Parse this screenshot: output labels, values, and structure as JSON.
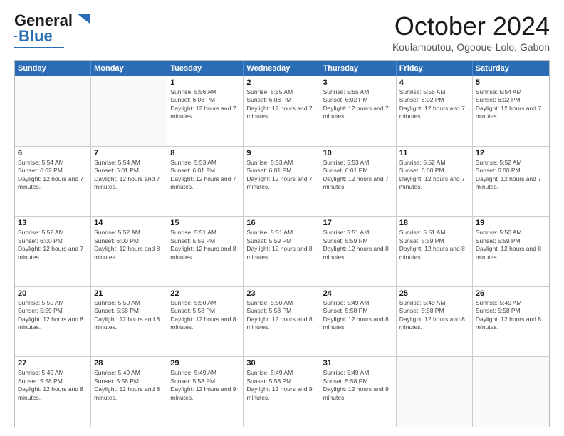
{
  "logo": {
    "line1": "General",
    "line2": "Blue"
  },
  "header": {
    "title": "October 2024",
    "location": "Koulamoutou, Ogooue-Lolo, Gabon"
  },
  "days_of_week": [
    "Sunday",
    "Monday",
    "Tuesday",
    "Wednesday",
    "Thursday",
    "Friday",
    "Saturday"
  ],
  "weeks": [
    [
      {
        "day": "",
        "content": ""
      },
      {
        "day": "",
        "content": ""
      },
      {
        "day": "1",
        "content": "Sunrise: 5:56 AM\nSunset: 6:03 PM\nDaylight: 12 hours and 7 minutes."
      },
      {
        "day": "2",
        "content": "Sunrise: 5:55 AM\nSunset: 6:03 PM\nDaylight: 12 hours and 7 minutes."
      },
      {
        "day": "3",
        "content": "Sunrise: 5:55 AM\nSunset: 6:02 PM\nDaylight: 12 hours and 7 minutes."
      },
      {
        "day": "4",
        "content": "Sunrise: 5:55 AM\nSunset: 6:02 PM\nDaylight: 12 hours and 7 minutes."
      },
      {
        "day": "5",
        "content": "Sunrise: 5:54 AM\nSunset: 6:02 PM\nDaylight: 12 hours and 7 minutes."
      }
    ],
    [
      {
        "day": "6",
        "content": "Sunrise: 5:54 AM\nSunset: 6:02 PM\nDaylight: 12 hours and 7 minutes."
      },
      {
        "day": "7",
        "content": "Sunrise: 5:54 AM\nSunset: 6:01 PM\nDaylight: 12 hours and 7 minutes."
      },
      {
        "day": "8",
        "content": "Sunrise: 5:53 AM\nSunset: 6:01 PM\nDaylight: 12 hours and 7 minutes."
      },
      {
        "day": "9",
        "content": "Sunrise: 5:53 AM\nSunset: 6:01 PM\nDaylight: 12 hours and 7 minutes."
      },
      {
        "day": "10",
        "content": "Sunrise: 5:53 AM\nSunset: 6:01 PM\nDaylight: 12 hours and 7 minutes."
      },
      {
        "day": "11",
        "content": "Sunrise: 5:52 AM\nSunset: 6:00 PM\nDaylight: 12 hours and 7 minutes."
      },
      {
        "day": "12",
        "content": "Sunrise: 5:52 AM\nSunset: 6:00 PM\nDaylight: 12 hours and 7 minutes."
      }
    ],
    [
      {
        "day": "13",
        "content": "Sunrise: 5:52 AM\nSunset: 6:00 PM\nDaylight: 12 hours and 7 minutes."
      },
      {
        "day": "14",
        "content": "Sunrise: 5:52 AM\nSunset: 6:00 PM\nDaylight: 12 hours and 8 minutes."
      },
      {
        "day": "15",
        "content": "Sunrise: 5:51 AM\nSunset: 5:59 PM\nDaylight: 12 hours and 8 minutes."
      },
      {
        "day": "16",
        "content": "Sunrise: 5:51 AM\nSunset: 5:59 PM\nDaylight: 12 hours and 8 minutes."
      },
      {
        "day": "17",
        "content": "Sunrise: 5:51 AM\nSunset: 5:59 PM\nDaylight: 12 hours and 8 minutes."
      },
      {
        "day": "18",
        "content": "Sunrise: 5:51 AM\nSunset: 5:59 PM\nDaylight: 12 hours and 8 minutes."
      },
      {
        "day": "19",
        "content": "Sunrise: 5:50 AM\nSunset: 5:59 PM\nDaylight: 12 hours and 8 minutes."
      }
    ],
    [
      {
        "day": "20",
        "content": "Sunrise: 5:50 AM\nSunset: 5:59 PM\nDaylight: 12 hours and 8 minutes."
      },
      {
        "day": "21",
        "content": "Sunrise: 5:50 AM\nSunset: 5:58 PM\nDaylight: 12 hours and 8 minutes."
      },
      {
        "day": "22",
        "content": "Sunrise: 5:50 AM\nSunset: 5:58 PM\nDaylight: 12 hours and 8 minutes."
      },
      {
        "day": "23",
        "content": "Sunrise: 5:50 AM\nSunset: 5:58 PM\nDaylight: 12 hours and 8 minutes."
      },
      {
        "day": "24",
        "content": "Sunrise: 5:49 AM\nSunset: 5:58 PM\nDaylight: 12 hours and 8 minutes."
      },
      {
        "day": "25",
        "content": "Sunrise: 5:49 AM\nSunset: 5:58 PM\nDaylight: 12 hours and 8 minutes."
      },
      {
        "day": "26",
        "content": "Sunrise: 5:49 AM\nSunset: 5:58 PM\nDaylight: 12 hours and 8 minutes."
      }
    ],
    [
      {
        "day": "27",
        "content": "Sunrise: 5:49 AM\nSunset: 5:58 PM\nDaylight: 12 hours and 8 minutes."
      },
      {
        "day": "28",
        "content": "Sunrise: 5:49 AM\nSunset: 5:58 PM\nDaylight: 12 hours and 8 minutes."
      },
      {
        "day": "29",
        "content": "Sunrise: 5:49 AM\nSunset: 5:58 PM\nDaylight: 12 hours and 9 minutes."
      },
      {
        "day": "30",
        "content": "Sunrise: 5:49 AM\nSunset: 5:58 PM\nDaylight: 12 hours and 9 minutes."
      },
      {
        "day": "31",
        "content": "Sunrise: 5:49 AM\nSunset: 5:58 PM\nDaylight: 12 hours and 9 minutes."
      },
      {
        "day": "",
        "content": ""
      },
      {
        "day": "",
        "content": ""
      }
    ]
  ]
}
